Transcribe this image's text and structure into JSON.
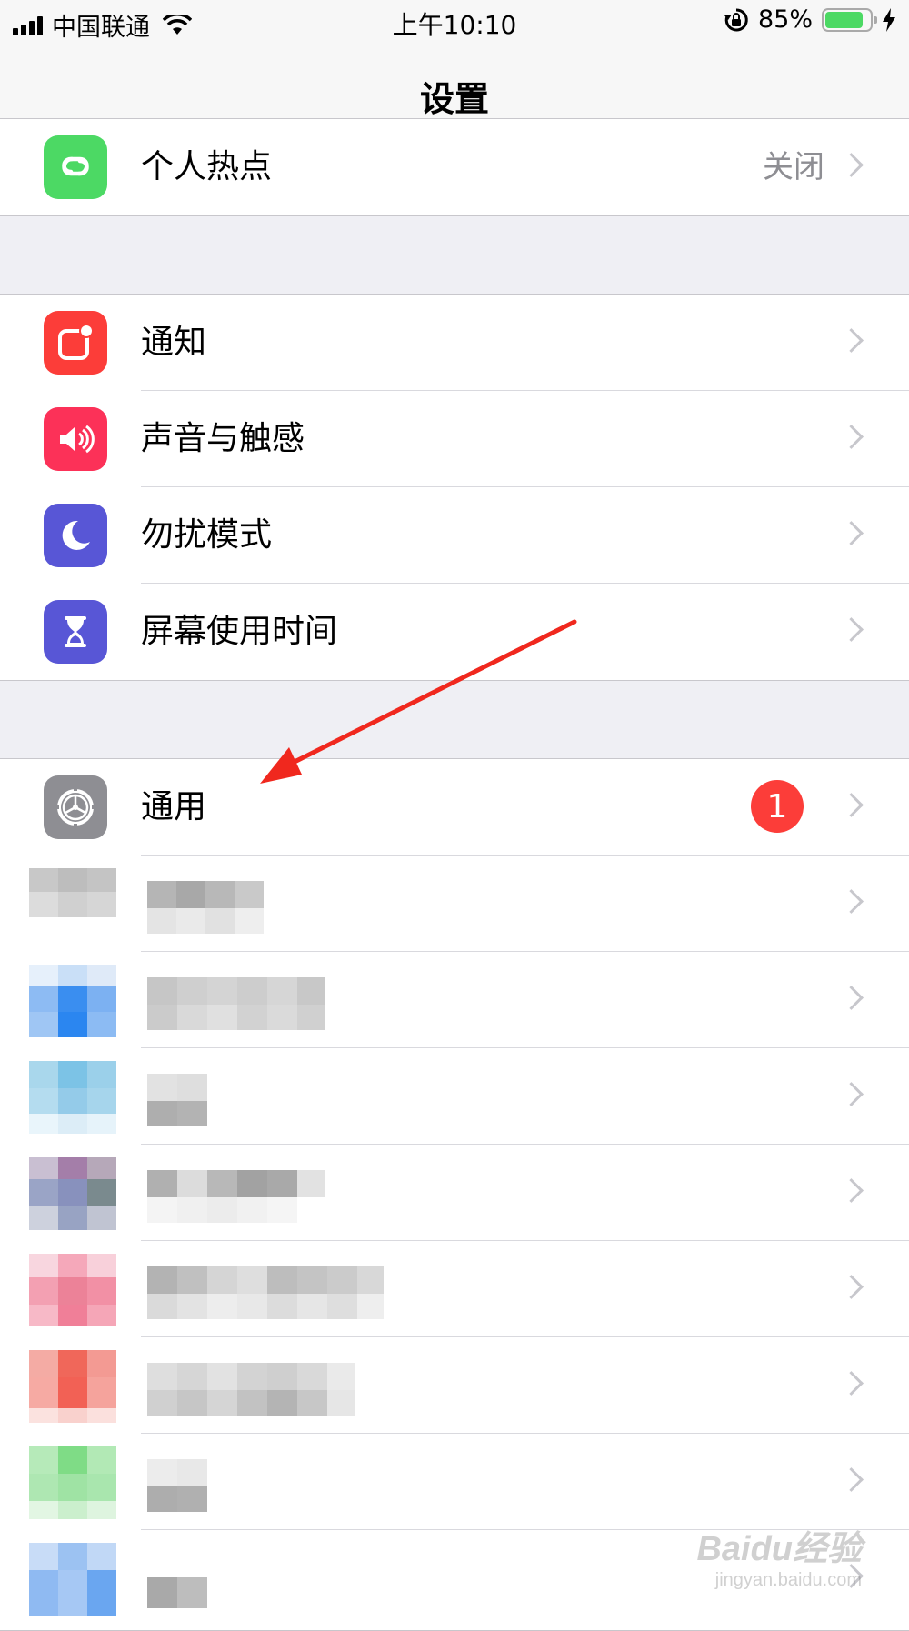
{
  "status_bar": {
    "carrier": "中国联通",
    "time": "上午10:10",
    "battery_percent": "85%",
    "battery_level": 0.85,
    "battery_color": "#4cd964",
    "signal_icon": "cellular-signal-icon",
    "wifi_icon": "wifi-icon",
    "rotation_lock_icon": "rotation-lock-icon",
    "charging_icon": "charging-bolt-icon"
  },
  "nav": {
    "title": "设置"
  },
  "group_hotspot": {
    "rows": [
      {
        "label": "个人热点",
        "value": "关闭",
        "icon": "hotspot-icon",
        "icon_color": "#4cd964"
      }
    ]
  },
  "group_notifications": {
    "rows": [
      {
        "label": "通知",
        "icon": "notifications-icon",
        "icon_color": "#fc3d39"
      },
      {
        "label": "声音与触感",
        "icon": "speaker-icon",
        "icon_color": "#fc3158"
      },
      {
        "label": "勿扰模式",
        "icon": "moon-icon",
        "icon_color": "#5856d6"
      },
      {
        "label": "屏幕使用时间",
        "icon": "hourglass-icon",
        "icon_color": "#5856d6"
      }
    ]
  },
  "group_general": {
    "rows": [
      {
        "label": "通用",
        "badge": "1",
        "badge_color": "#fc3d39",
        "icon": "gear-icon",
        "icon_color": "#8e8e93"
      }
    ]
  },
  "annotation": {
    "arrow_color": "#f0281e"
  },
  "watermark": {
    "line1": "Baidu经验",
    "line2": "jingyan.baidu.com"
  }
}
